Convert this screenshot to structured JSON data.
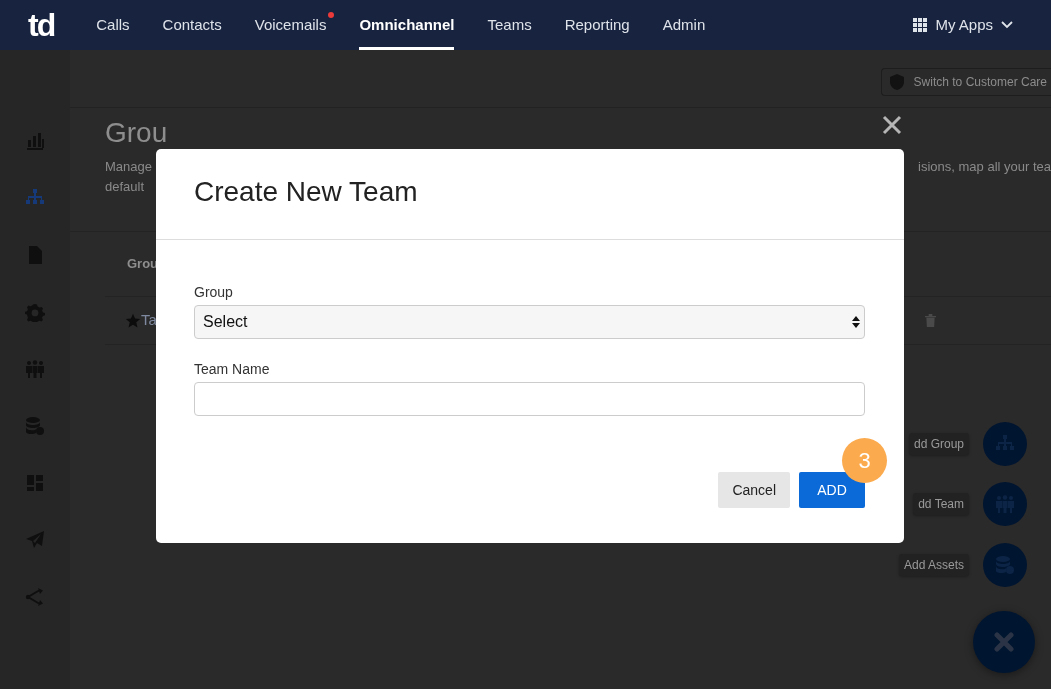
{
  "nav": {
    "logo": "td",
    "links": [
      {
        "label": "Calls",
        "selected": false,
        "notification": false
      },
      {
        "label": "Contacts",
        "selected": false,
        "notification": false
      },
      {
        "label": "Voicemails",
        "selected": false,
        "notification": true
      },
      {
        "label": "Omnichannel",
        "selected": true,
        "notification": false
      },
      {
        "label": "Teams",
        "selected": false,
        "notification": false
      },
      {
        "label": "Reporting",
        "selected": false,
        "notification": false
      },
      {
        "label": "Admin",
        "selected": false,
        "notification": false
      }
    ],
    "apps": "My Apps"
  },
  "toolbar": {
    "switch_button": "Switch to Customer Care"
  },
  "sidebar": {
    "items": [
      {
        "kind": "chart",
        "selected": false
      },
      {
        "kind": "hierarchy",
        "selected": true
      },
      {
        "kind": "document",
        "selected": false
      },
      {
        "kind": "gear",
        "selected": false
      },
      {
        "kind": "people",
        "selected": false
      },
      {
        "kind": "database",
        "selected": false
      },
      {
        "kind": "layout",
        "selected": false
      },
      {
        "kind": "send",
        "selected": false
      },
      {
        "kind": "branch",
        "selected": false
      }
    ]
  },
  "page": {
    "title": "Grou",
    "description_line_1": "Manage",
    "description_line_1_end": "isions, map all your tea",
    "description_line_2": "default",
    "table": {
      "header": "Grou",
      "rows": [
        {
          "name": "Ta",
          "starred": true
        }
      ]
    }
  },
  "fab": {
    "actions": [
      {
        "label": "dd Group",
        "kind": "hierarchy"
      },
      {
        "label": "dd Team",
        "kind": "people"
      },
      {
        "label": "Add Assets",
        "kind": "database"
      }
    ]
  },
  "modal": {
    "title": "Create New Team",
    "fields": [
      {
        "kind": "select",
        "label": "Group",
        "value": "Select"
      },
      {
        "kind": "text",
        "label": "Team Name"
      }
    ],
    "buttons": [
      {
        "label": "Cancel",
        "kind": "secondary"
      },
      {
        "label": "ADD",
        "kind": "primary"
      }
    ],
    "step_badge": "3"
  }
}
